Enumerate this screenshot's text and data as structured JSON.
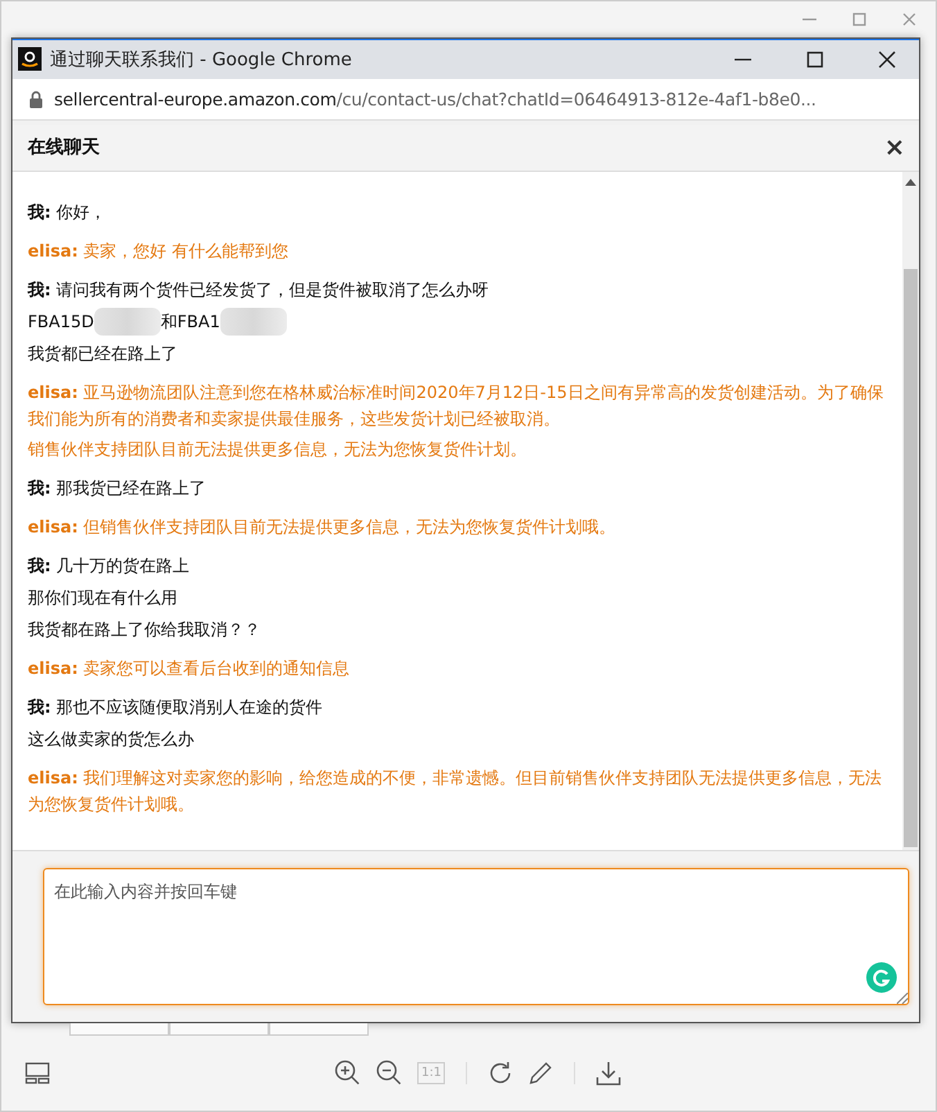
{
  "window": {
    "title": "通过聊天联系我们 - Google Chrome"
  },
  "address_bar": {
    "host": "sellercentral-europe.amazon.com",
    "path": "/cu/contact-us/chat?chatId=06464913-812e-4af1-b8e0..."
  },
  "chat": {
    "title": "在线聊天",
    "close": "×",
    "messages": [
      {
        "kind": "me",
        "sender": "我:",
        "lines": [
          {
            "text": "你好，"
          }
        ]
      },
      {
        "kind": "agent",
        "sender": "elisa:",
        "lines": [
          {
            "text": "卖家，您好 有什么能帮到您"
          }
        ]
      },
      {
        "kind": "me",
        "sender": "我:",
        "lines": [
          {
            "text": "请问我有两个货件已经发货了，但是货件被取消了怎么办呀"
          },
          {
            "segments": [
              {
                "kind": "text",
                "text": "FBA15D"
              },
              {
                "kind": "blur"
              },
              {
                "kind": "text",
                "text": "和FBA1"
              },
              {
                "kind": "blur"
              }
            ]
          },
          {
            "text": "我货都已经在路上了"
          }
        ]
      },
      {
        "kind": "agent",
        "sender": "elisa:",
        "lines": [
          {
            "text": "亚马逊物流团队注意到您在格林威治标准时间2020年7月12日-15日之间有异常高的发货创建活动。为了确保我们能为所有的消费者和卖家提供最佳服务，这些发货计划已经被取消。"
          },
          {
            "text": "销售伙伴支持团队目前无法提供更多信息，无法为您恢复货件计划。"
          }
        ]
      },
      {
        "kind": "me",
        "sender": "我:",
        "lines": [
          {
            "text": "那我货已经在路上了"
          }
        ]
      },
      {
        "kind": "agent",
        "sender": "elisa:",
        "lines": [
          {
            "text": "但销售伙伴支持团队目前无法提供更多信息，无法为您恢复货件计划哦。"
          }
        ]
      },
      {
        "kind": "me",
        "sender": "我:",
        "lines": [
          {
            "text": "几十万的货在路上"
          },
          {
            "text": "那你们现在有什么用"
          },
          {
            "text": "我货都在路上了你给我取消？？"
          }
        ]
      },
      {
        "kind": "agent",
        "sender": "elisa:",
        "lines": [
          {
            "text": "卖家您可以查看后台收到的通知信息"
          }
        ]
      },
      {
        "kind": "me",
        "sender": "我:",
        "lines": [
          {
            "text": "那也不应该随便取消别人在途的货件"
          },
          {
            "text": "这么做卖家的货怎么办"
          }
        ]
      },
      {
        "kind": "agent",
        "sender": "elisa:",
        "lines": [
          {
            "text": "我们理解这对卖家您的影响，给您造成的不便，非常遗憾。但目前销售伙伴支持团队无法提供更多信息，无法为您恢复货件计划哦。"
          }
        ]
      }
    ],
    "input": {
      "placeholder": "在此输入内容并按回车键"
    }
  },
  "toolbar": {
    "actual_size": "1:1"
  }
}
